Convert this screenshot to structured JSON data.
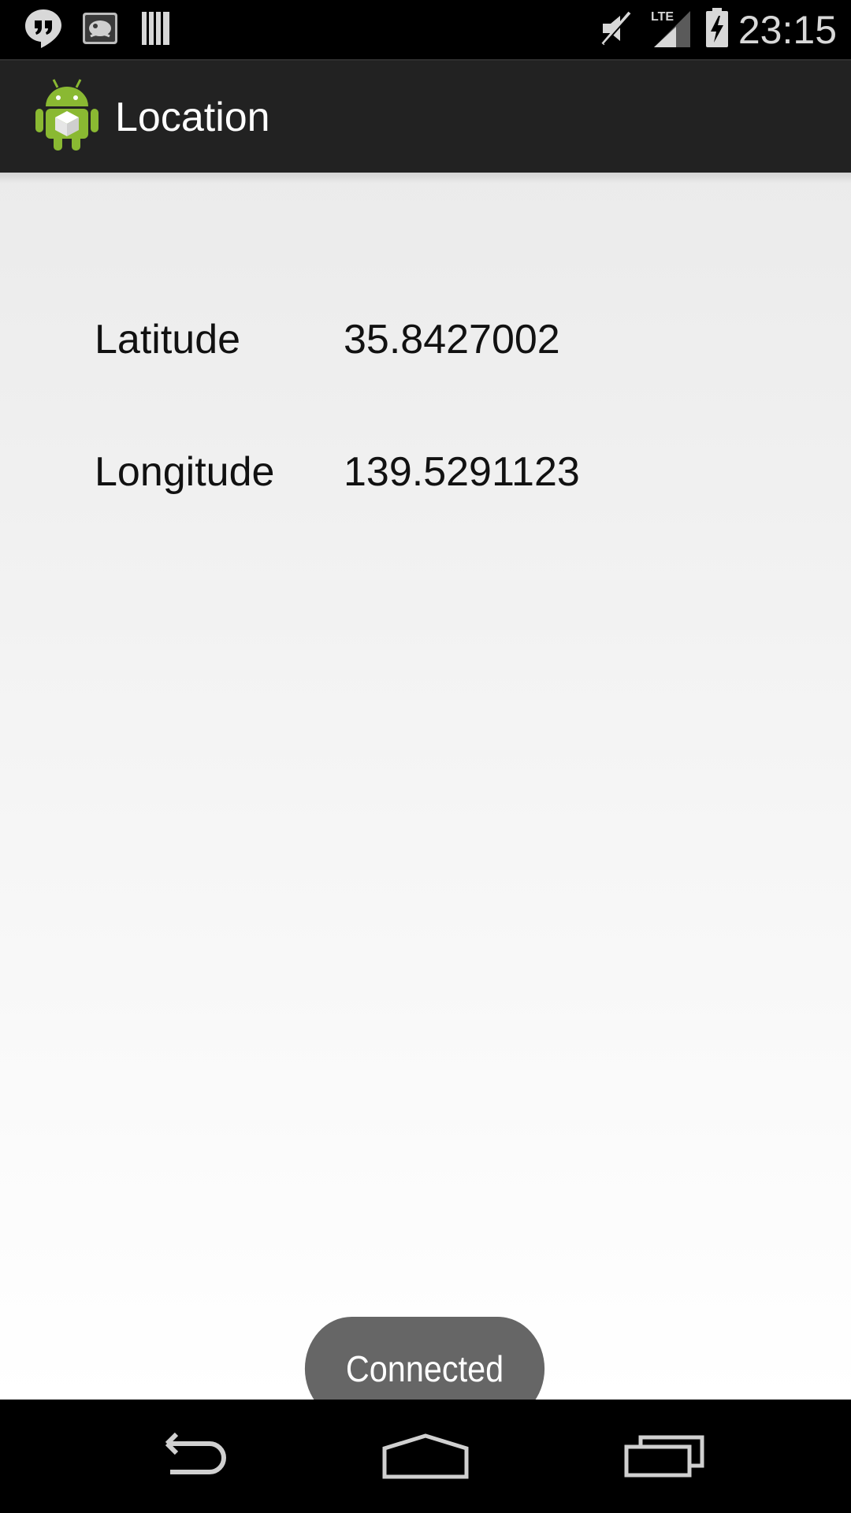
{
  "status_bar": {
    "time": "23:15",
    "icons": [
      "hangouts-icon",
      "notification-image-icon",
      "barcode-icon",
      "mute-icon",
      "lte-signal-icon",
      "battery-charging-icon"
    ],
    "network": "LTE"
  },
  "action_bar": {
    "title": "Location",
    "icon": "android-app-icon"
  },
  "location": {
    "latitude_label": "Latitude",
    "latitude_value": "35.8427002",
    "longitude_label": "Longitude",
    "longitude_value": "139.5291123"
  },
  "toast": {
    "message": "Connected"
  },
  "nav_bar": {
    "buttons": [
      "back-icon",
      "home-icon",
      "recent-apps-icon"
    ]
  },
  "colors": {
    "status_bar": "#000000",
    "action_bar": "#222222",
    "toast_bg": "#666666",
    "android_green": "#8ab932"
  }
}
